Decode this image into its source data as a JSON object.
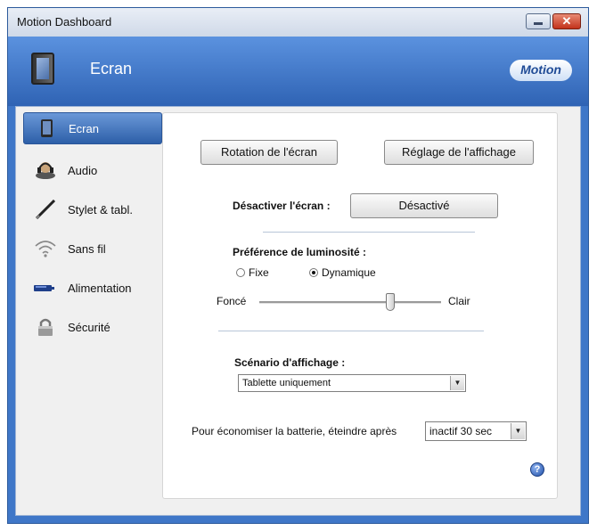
{
  "window": {
    "title": "Motion Dashboard"
  },
  "header": {
    "section": "Ecran",
    "logo": "Motion"
  },
  "sidebar": {
    "items": [
      {
        "label": "Ecran",
        "icon": "tablet-icon",
        "active": true
      },
      {
        "label": "Audio",
        "icon": "headset-icon"
      },
      {
        "label": "Stylet & tabl.",
        "icon": "pen-icon"
      },
      {
        "label": "Sans fil",
        "icon": "wireless-icon"
      },
      {
        "label": "Alimentation",
        "icon": "battery-icon"
      },
      {
        "label": "Sécurité",
        "icon": "lock-icon"
      }
    ]
  },
  "main": {
    "rotation_button": "Rotation de l'écran",
    "display_settings_button": "Réglage de l'affichage",
    "disable_screen_label": "Désactiver l'écran :",
    "disable_screen_button": "Désactivé",
    "brightness_label": "Préférence de luminosité :",
    "radio_fixed": "Fixe",
    "radio_dynamic": "Dynamique",
    "selected_brightness_mode": "Dynamique",
    "slider_left": "Foncé",
    "slider_right": "Clair",
    "slider_value": 0.72,
    "scenario_label": "Scénario d'affichage :",
    "scenario_value": "Tablette uniquement",
    "battery_label": "Pour économiser la batterie, éteindre après",
    "battery_value": "inactif 30 sec",
    "help": "?"
  },
  "colors": {
    "accent": "#3f77c8",
    "header": "#2f63b4",
    "close": "#c2321b"
  }
}
